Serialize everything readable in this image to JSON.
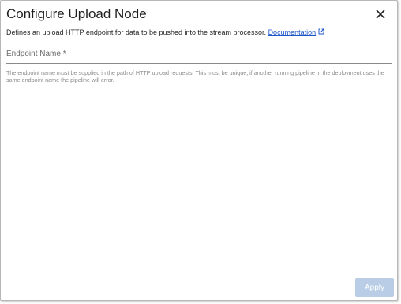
{
  "dialog": {
    "title": "Configure Upload Node",
    "description": "Defines an upload HTTP endpoint for data to be pushed into the stream processor.",
    "doc_link": "Documentation",
    "close_icon": "close-icon",
    "external_icon": "external-link-icon"
  },
  "field": {
    "label": "Endpoint Name *",
    "value": "",
    "helper": "The endpoint name must be supplied in the path of HTTP upload requests. This must be unique, if another running pipeline in the deployment uses the same endpoint name the pipeline will error."
  },
  "footer": {
    "apply_label": "Apply"
  },
  "colors": {
    "link": "#1a56c9",
    "apply_disabled_bg": "#b9cde6"
  }
}
